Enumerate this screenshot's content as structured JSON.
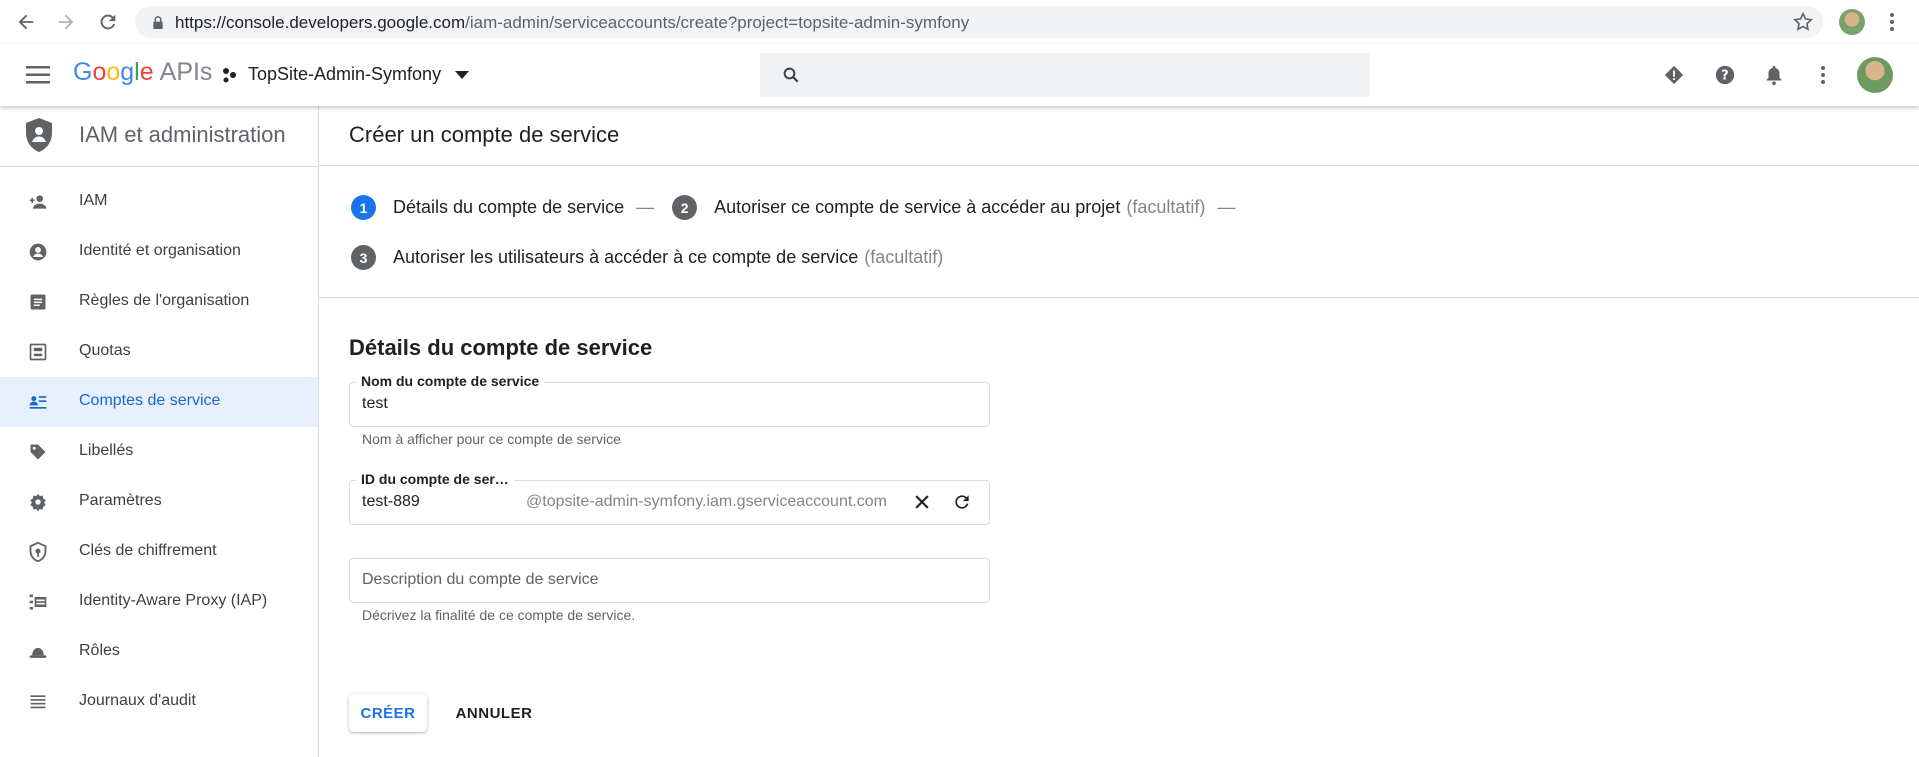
{
  "browser": {
    "url_host": "https://console.developers.google.com",
    "url_path": "/iam-admin/serviceaccounts/create?project=topsite-admin-symfony"
  },
  "header": {
    "logo_letters": [
      "G",
      "o",
      "o",
      "g",
      "l",
      "e"
    ],
    "apis": "APIs",
    "project": "TopSite-Admin-Symfony"
  },
  "sidebar": {
    "title": "IAM et administration",
    "items": [
      {
        "label": "IAM",
        "icon": "person-add-icon"
      },
      {
        "label": "Identité et organisation",
        "icon": "account-circle-icon"
      },
      {
        "label": "Règles de l'organisation",
        "icon": "list-alt-icon"
      },
      {
        "label": "Quotas",
        "icon": "quota-icon"
      },
      {
        "label": "Comptes de service",
        "icon": "service-account-icon",
        "active": true
      },
      {
        "label": "Libellés",
        "icon": "label-icon"
      },
      {
        "label": "Paramètres",
        "icon": "gear-icon"
      },
      {
        "label": "Clés de chiffrement",
        "icon": "shield-key-icon"
      },
      {
        "label": "Identity-Aware Proxy (IAP)",
        "icon": "iap-icon"
      },
      {
        "label": "Rôles",
        "icon": "hat-icon"
      },
      {
        "label": "Journaux d'audit",
        "icon": "list-lines-icon"
      }
    ]
  },
  "main": {
    "title": "Créer un compte de service",
    "steps": [
      {
        "num": "1",
        "label": "Détails du compte de service",
        "optional": ""
      },
      {
        "num": "2",
        "label": "Autoriser ce compte de service à accéder au projet",
        "optional": "(facultatif)"
      },
      {
        "num": "3",
        "label": "Autoriser les utilisateurs à accéder à ce compte de service",
        "optional": "(facultatif)"
      }
    ],
    "step_separator": "—",
    "section_title": "Détails du compte de service",
    "name_field": {
      "label": "Nom du compte de service",
      "value": "test",
      "hint": "Nom à afficher pour ce compte de service"
    },
    "id_field": {
      "label": "ID du compte de ser…",
      "value": "test-889",
      "suffix": "@topsite-admin-symfony.iam.gserviceaccount.com"
    },
    "description_field": {
      "placeholder": "Description du compte de service",
      "hint": "Décrivez la finalité de ce compte de service."
    },
    "create_label": "CRÉER",
    "cancel_label": "ANNULER"
  },
  "colors": {
    "accent": "#1a73e8",
    "active_bg": "#e8f0fe",
    "active_text": "#1967d2"
  }
}
